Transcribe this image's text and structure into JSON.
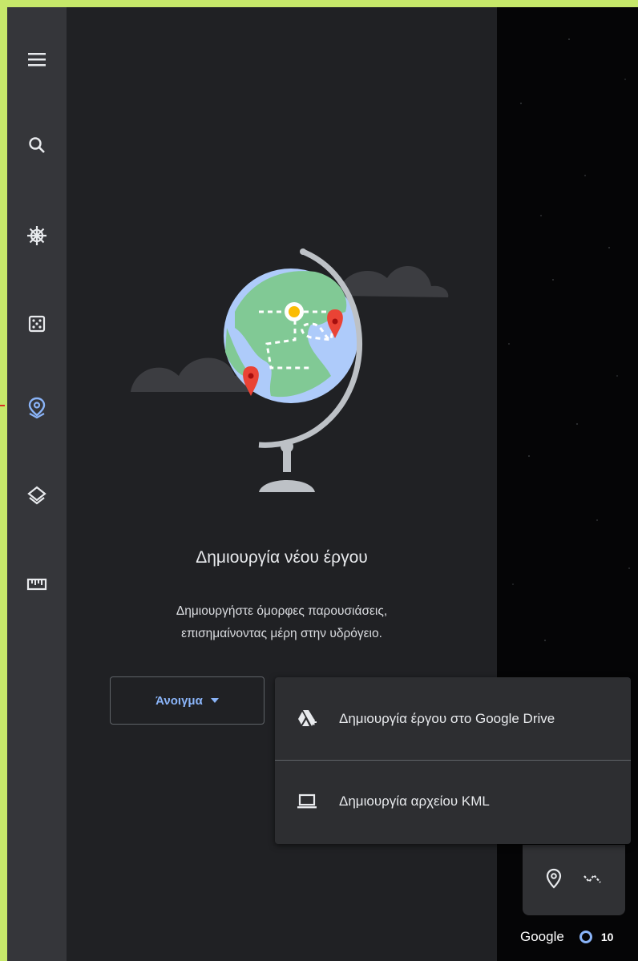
{
  "rail": {
    "items": [
      {
        "name": "menu-icon"
      },
      {
        "name": "search-icon"
      },
      {
        "name": "voyager-icon"
      },
      {
        "name": "feeling-lucky-icon"
      },
      {
        "name": "projects-icon",
        "active": true
      },
      {
        "name": "map-style-icon"
      },
      {
        "name": "measure-icon"
      }
    ],
    "active_color": "#8ab4f8"
  },
  "empty_state": {
    "title": "Δημιουργία νέου έργου",
    "description_line1": "Δημιουργήστε όμορφες παρουσιάσεις,",
    "description_line2": "επισημαίνοντας μέρη στην υδρόγειο."
  },
  "open_button": {
    "label": "Άνοιγμα",
    "icon": "arrow-drop-down-icon"
  },
  "create_menu": {
    "items": [
      {
        "icon": "google-drive-add-icon",
        "label": "Δημιουργία έργου στο Google Drive"
      },
      {
        "icon": "laptop-icon",
        "label": "Δημιουργία αρχείου KML"
      }
    ]
  },
  "map_tools": {
    "items": [
      {
        "icon": "add-placemark-icon"
      },
      {
        "icon": "draw-path-icon"
      }
    ]
  },
  "footer": {
    "brand": "Google",
    "zoom_text": "10"
  },
  "colors": {
    "rail_bg": "#35363a",
    "panel_bg": "#202124",
    "accent": "#8ab4f8",
    "pin_red": "#ea4335",
    "pin_yellow": "#fbbc04",
    "outer_frame": "#c6e86a"
  }
}
